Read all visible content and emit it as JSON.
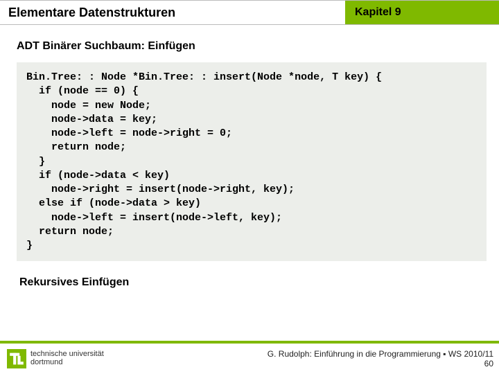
{
  "header": {
    "title": "Elementare Datenstrukturen",
    "chapter": "Kapitel 9"
  },
  "subtitle": "ADT Binärer Suchbaum: Einfügen",
  "code": "Bin.Tree: : Node *Bin.Tree: : insert(Node *node, T key) {\n  if (node == 0) {\n    node = new Node;\n    node->data = key;\n    node->left = node->right = 0;\n    return node;\n  }\n  if (node->data < key)\n    node->right = insert(node->right, key);\n  else if (node->data > key)\n    node->left = insert(node->left, key);\n  return node;\n}",
  "note": "Rekursives Einfügen",
  "footer": {
    "uni_line1": "technische universität",
    "uni_line2": "dortmund",
    "credit": "G. Rudolph: Einführung in die Programmierung ▪ WS 2010/11",
    "page": "60"
  }
}
